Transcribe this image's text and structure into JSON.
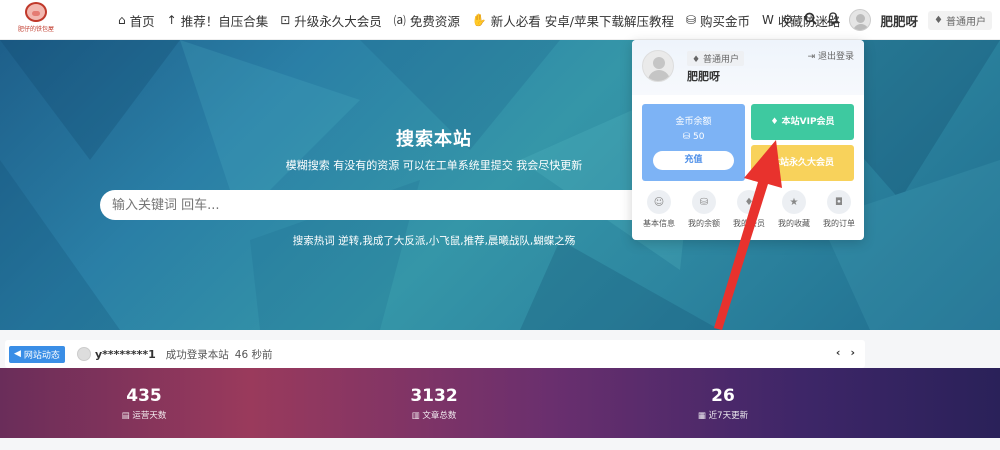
{
  "logo": {
    "text": "肥仔的铁包屋"
  },
  "nav": {
    "items": [
      {
        "icon": "⌂",
        "label": "首页"
      },
      {
        "icon": "↑",
        "label": "推荐！自压合集"
      },
      {
        "icon": "⊡",
        "label": "升级永久大会员"
      },
      {
        "icon": "⒜",
        "label": "免费资源"
      },
      {
        "icon": "✋",
        "label": "新人必看 安卓/苹果下载解压教程"
      },
      {
        "icon": "⛁",
        "label": "购买金币"
      },
      {
        "icon": "W",
        "label": "收藏防迷路"
      }
    ],
    "user_name": "肥肥呀",
    "user_badge": "普通用户"
  },
  "hero": {
    "title": "搜索本站",
    "subtitle": "模糊搜索 有没有的资源 可以在工单系统里提交 我会尽快更新",
    "search_placeholder": "输入关键词 回车...",
    "hot_words": "搜索热词  逆转,我成了大反派,小飞鼠,推荐,晨曦战队,蝴蝶之殇"
  },
  "dropdown": {
    "badge": "普通用户",
    "name": "肥肥呀",
    "logout": "退出登录",
    "coin_label": "金币余额",
    "coin_value": "50",
    "recharge": "充值",
    "vip": "本站VIP会员",
    "permanent": "本站永久大会员",
    "menu": [
      {
        "icon": "user-icon",
        "glyph": "☺",
        "label": "基本信息"
      },
      {
        "icon": "coins-icon",
        "glyph": "⛁",
        "label": "我的余额"
      },
      {
        "icon": "vip-icon",
        "glyph": "♦",
        "label": "我的会员"
      },
      {
        "icon": "star-icon",
        "glyph": "★",
        "label": "我的收藏"
      },
      {
        "icon": "bag-icon",
        "glyph": "◘",
        "label": "我的订单"
      }
    ]
  },
  "ticker": {
    "tag": "网站动态",
    "user": "y********1",
    "message": "成功登录本站",
    "time": "46 秒前"
  },
  "stats": [
    {
      "value": "435",
      "label": "运营天数",
      "icon": "chart-icon"
    },
    {
      "value": "3132",
      "label": "文章总数",
      "icon": "database-icon"
    },
    {
      "value": "26",
      "label": "近7天更新",
      "icon": "calendar-icon"
    }
  ],
  "colors": {
    "vip_card": "#3ec9a0",
    "permanent_card": "#f8d25b",
    "coin_card": "#7db3f5",
    "tag_blue": "#3a8ee6",
    "arrow_red": "#e8322d"
  }
}
